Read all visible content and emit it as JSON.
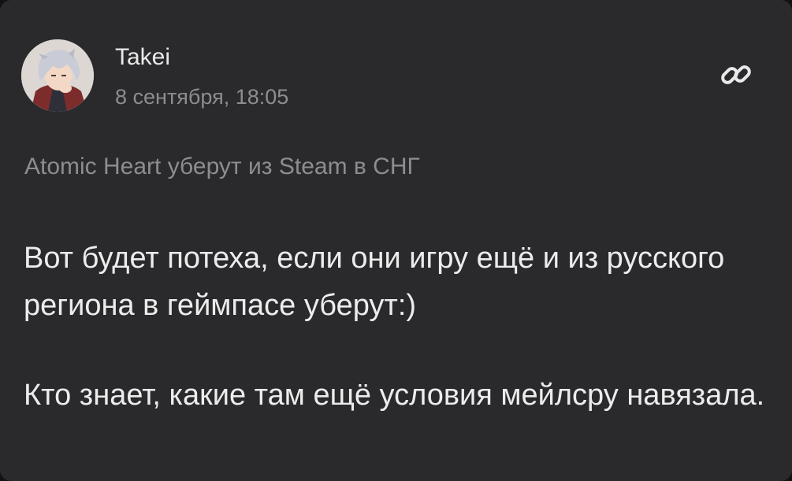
{
  "post": {
    "author": "Takei",
    "timestamp": "8 сентября, 18:05",
    "thread_title": "Atomic Heart уберут из Steam в СНГ",
    "paragraphs": [
      "Вот будет потеха, если они игру ещё и из русского региона в геймпасе уберут:)",
      "Кто знает, какие там ещё условия мейлсру навязала."
    ]
  },
  "icons": {
    "avatar": "anime-character-avatar",
    "link": "link-icon"
  },
  "colors": {
    "background": "#2a2a2c",
    "text_primary": "#ececed",
    "text_secondary": "#8d8d91"
  }
}
